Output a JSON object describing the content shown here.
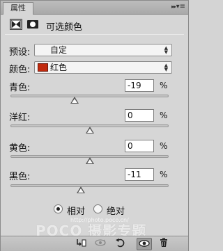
{
  "panel": {
    "tab_label": "属性",
    "collapse_glyph": "▸▸",
    "menu_glyph": "▾≡"
  },
  "header": {
    "title": "可选颜色"
  },
  "preset": {
    "label": "预设:",
    "value": "自定"
  },
  "colors": {
    "label": "颜色:",
    "value": "红色",
    "swatch_color": "#c12a0e"
  },
  "sliders": [
    {
      "label": "青色:",
      "value": "-19",
      "unit": "%",
      "level": -19
    },
    {
      "label": "洋红:",
      "value": "0",
      "unit": "%",
      "level": 0
    },
    {
      "label": "黄色:",
      "value": "0",
      "unit": "%",
      "level": 0
    },
    {
      "label": "黑色:",
      "value": "-11",
      "unit": "%",
      "level": -11
    }
  ],
  "method": {
    "relative_label": "相对",
    "absolute_label": "绝对",
    "selected": "relative"
  },
  "watermark": {
    "text": "POCO 摄影专题",
    "url": "http://photo.poco.cn/"
  },
  "toolbar": {
    "icons": [
      "clip-to-layer-icon",
      "view-previous-icon",
      "reset-icon",
      "visibility-eye-icon",
      "trash-icon"
    ]
  }
}
